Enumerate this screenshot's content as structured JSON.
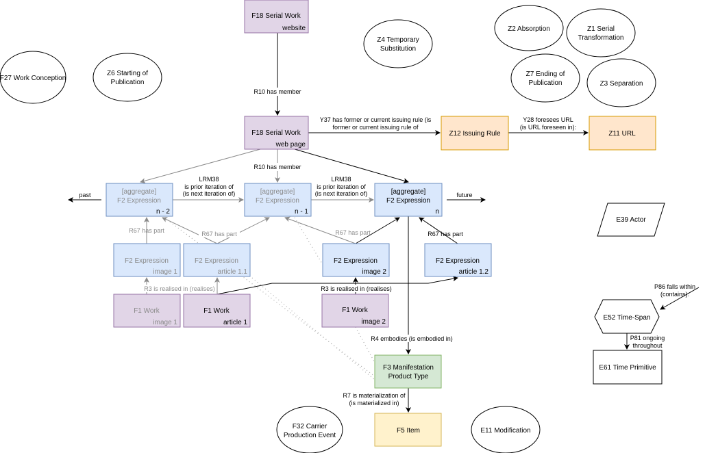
{
  "nodes": {
    "serial_work_website": {
      "title": "F18 Serial Work",
      "sub": "website"
    },
    "serial_work_webpage": {
      "title": "F18 Serial Work",
      "sub": "web page"
    },
    "issuing_rule": "Z12 Issuing Rule",
    "url": "Z11 URL",
    "agg_n2": {
      "line1": "[aggregate]",
      "line2": "F2 Expression",
      "sub": "n - 2"
    },
    "agg_n1": {
      "line1": "[aggregate]",
      "line2": "F2 Expression",
      "sub": "n - 1"
    },
    "agg_n": {
      "line1": "[aggregate]",
      "line2": "F2 Expression",
      "sub": "n"
    },
    "expr_image1": {
      "title": "F2 Expression",
      "sub": "image 1"
    },
    "expr_article11": {
      "title": "F2 Expression",
      "sub": "article 1.1"
    },
    "expr_image2": {
      "title": "F2 Expression",
      "sub": "image 2"
    },
    "expr_article12": {
      "title": "F2 Expression",
      "sub": "article 1.2"
    },
    "work_image1": {
      "title": "F1 Work",
      "sub": "image 1"
    },
    "work_article1": {
      "title": "F1 Work",
      "sub": "article 1"
    },
    "work_image2": {
      "title": "F1 Work",
      "sub": "image 2"
    },
    "manifestation": {
      "line1": "F3 Manifestation",
      "line2": "Product Type"
    },
    "item": "F5 Item",
    "actor": "E39 Actor",
    "time_span": "E52 Time-Span",
    "time_primitive": "E61 Time Primitive",
    "work_conception": "F27 Work Conception",
    "starting_pub": {
      "line1": "Z6 Starting of",
      "line2": "Publication"
    },
    "temp_sub": {
      "line1": "Z4 Temporary",
      "line2": "Substitution"
    },
    "absorption": "Z2 Absorption",
    "serial_transf": {
      "line1": "Z1 Serial",
      "line2": "Transformation"
    },
    "ending_pub": {
      "line1": "Z7 Ending of",
      "line2": "Publication"
    },
    "separation": "Z3 Separation",
    "carrier_prod": {
      "line1": "F32 Carrier",
      "line2": "Production Event"
    },
    "modification": "E11 Modification"
  },
  "edges": {
    "r10_a": "R10 has member",
    "r10_b": "R10 has member",
    "y37": {
      "line1": "Y37 has former or current issuing rule (is",
      "line2": "former or current issuing rule of"
    },
    "y28": {
      "line1": "Y28 foresees URL",
      "line2": "(is URL foreseen in):"
    },
    "lrm38_a": {
      "line1": "LRM38",
      "line2": "is prior iteration of",
      "line3": "(is next iteration of)"
    },
    "lrm38_b": {
      "line1": "LRM38",
      "line2": "is prior iteration of",
      "line3": "(is next iteration of)"
    },
    "past": "past",
    "future": "future",
    "r67_a": "R67 has part",
    "r67_b": "R67 has part",
    "r67_c": "R67 has part",
    "r67_d": "R67 has part",
    "r3_a": "R3 is realised in (realises)",
    "r3_b": "R3 is realised in (realises)",
    "r4": "R4 embodies (is embodied in)",
    "r7": {
      "line1": "R7 is materialization of",
      "line2": "(is materialized in)"
    },
    "p86": {
      "line1": "P86 falls within",
      "line2": "(contains):"
    },
    "p81": {
      "line1": "P81 ongoing",
      "line2": "throughout"
    }
  },
  "colors": {
    "work": "#e1d5e7",
    "expression": "#dae8fc",
    "rule": "#ffe6cc",
    "manifestation": "#d5e8d4",
    "item": "#fff2cc"
  }
}
